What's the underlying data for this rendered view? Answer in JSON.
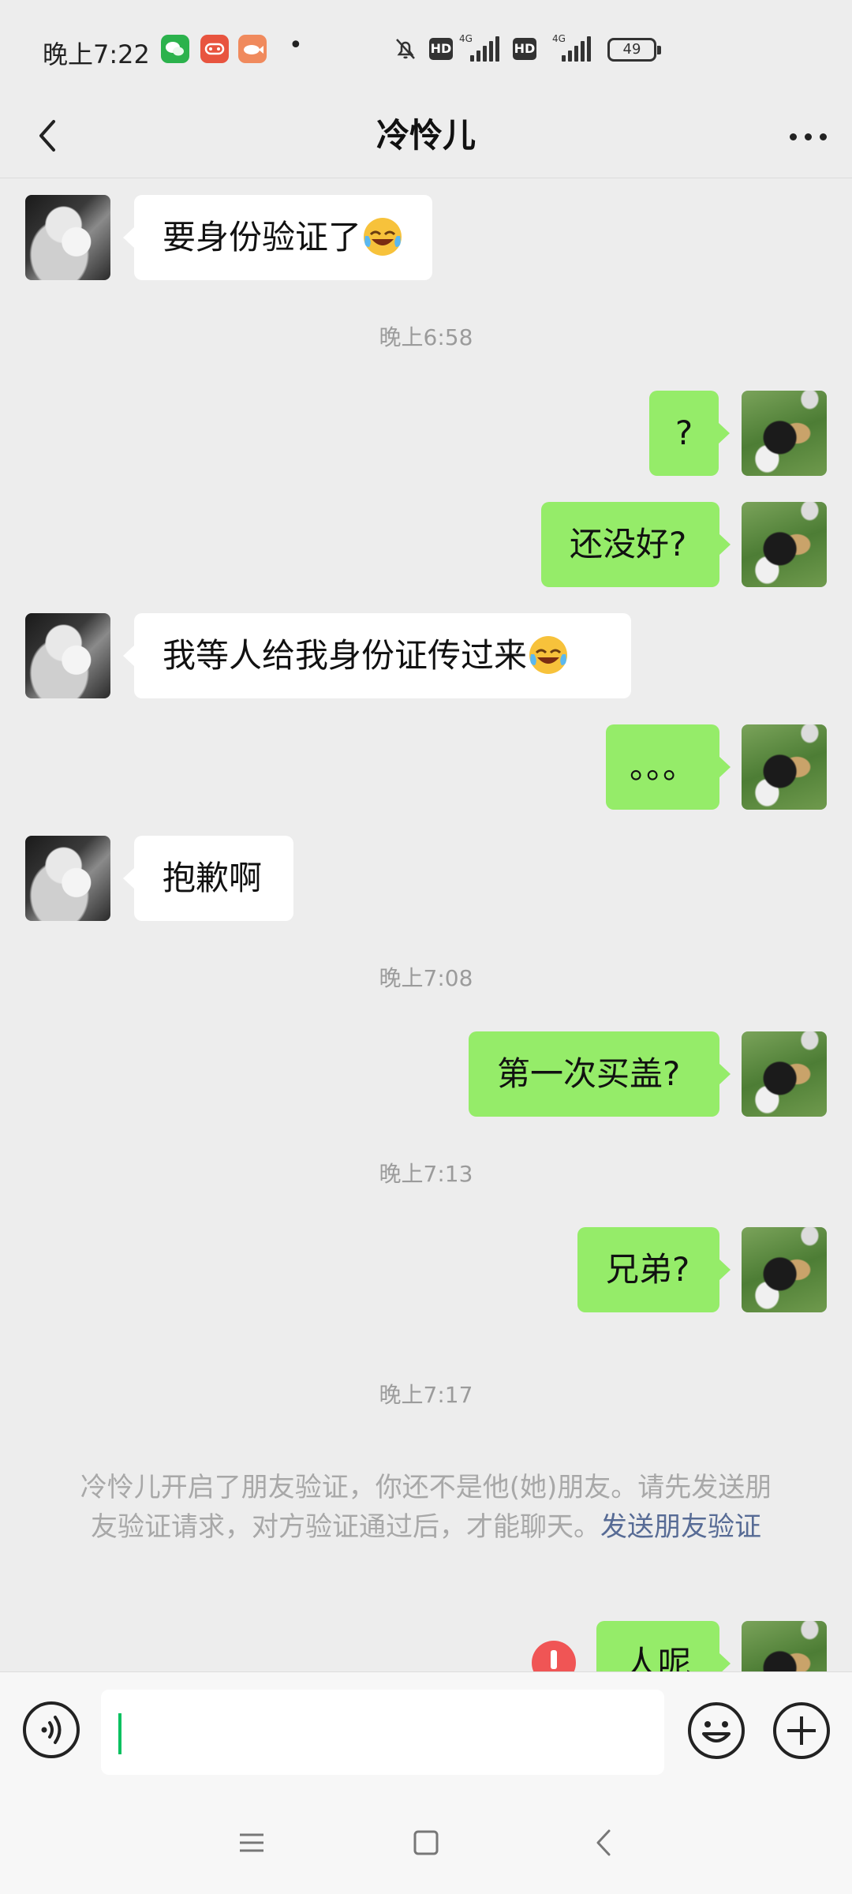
{
  "status_bar": {
    "time": "晚上7:22",
    "battery": "49",
    "network_1": "4G",
    "network_2": "4G",
    "hd_1": "HD",
    "hd_2": "HD",
    "app_icons": [
      "wechat-icon",
      "game-icon",
      "fish-app-icon"
    ]
  },
  "nav": {
    "title": "冷怜儿"
  },
  "timestamps": {
    "t1": "晚上6:58",
    "t2": "晚上7:08",
    "t3": "晚上7:13",
    "t4": "晚上7:17"
  },
  "messages": [
    {
      "side": "left",
      "text": "要身份验证了",
      "emoji": "rofl"
    },
    {
      "side": "right",
      "text": "?"
    },
    {
      "side": "right",
      "text": "还没好?"
    },
    {
      "side": "left",
      "text": "我等人给我身份证传过来",
      "emoji": "rofl"
    },
    {
      "side": "right",
      "text": "。。。"
    },
    {
      "side": "left",
      "text": "抱歉啊"
    },
    {
      "side": "right",
      "text": "第一次买盖?"
    },
    {
      "side": "right",
      "text": "兄弟?"
    },
    {
      "side": "right",
      "text": "人呢",
      "status": "failed"
    }
  ],
  "system_notice": {
    "text": "冷怜儿开启了朋友验证，你还不是他(她)朋友。请先发送朋友验证请求，对方验证通过后，才能聊天。",
    "link": "发送朋友验证"
  },
  "input": {
    "value": "",
    "placeholder": ""
  },
  "colors": {
    "background": "#ededed",
    "bubble_self": "#95ec69",
    "bubble_other": "#ffffff",
    "link": "#576b95",
    "error": "#f05555",
    "caret": "#07c160"
  }
}
